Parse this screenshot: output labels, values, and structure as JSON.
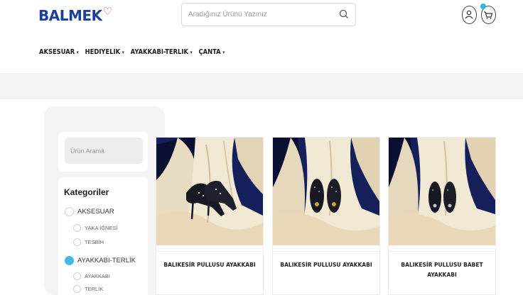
{
  "brand": {
    "name": "BALMEK",
    "accent": "#ef2b5a",
    "color": "#1d3f9c"
  },
  "header": {
    "search_placeholder": "Aradığınız Ürünü Yazınız",
    "icons": [
      "search-icon",
      "user-icon",
      "cart-icon"
    ]
  },
  "nav": [
    {
      "label": "AKSESUAR"
    },
    {
      "label": "HEDİYELİK"
    },
    {
      "label": "AYAKKABI-TERLİK"
    },
    {
      "label": "ÇANTA"
    }
  ],
  "sidebar": {
    "search_placeholder": "Ürün Arama",
    "categories_title": "Kategoriler",
    "items": [
      {
        "label": "AKSESUAR",
        "level": "top",
        "selected": false
      },
      {
        "label": "YAKA İĞNESİ",
        "level": "sub",
        "selected": false
      },
      {
        "label": "TESBİH",
        "level": "sub",
        "selected": false
      },
      {
        "label": "AYAKKABI-TERLİK",
        "level": "top",
        "selected": true
      },
      {
        "label": "AYAKKABI",
        "level": "sub",
        "selected": false
      },
      {
        "label": "TERLİK",
        "level": "sub",
        "selected": false
      }
    ],
    "selected_color": "#43b8e4"
  },
  "products": [
    {
      "name": "BALIKESİR PULLUSU AYAKKABI",
      "image": "high-heel-shoes"
    },
    {
      "name": "BALIKESİR PULLUSU AYAKKABI",
      "image": "flat-shoes"
    },
    {
      "name": "BALIKESİR PULLUSU BABET AYAKKABI",
      "image": "flat-shoes"
    }
  ]
}
